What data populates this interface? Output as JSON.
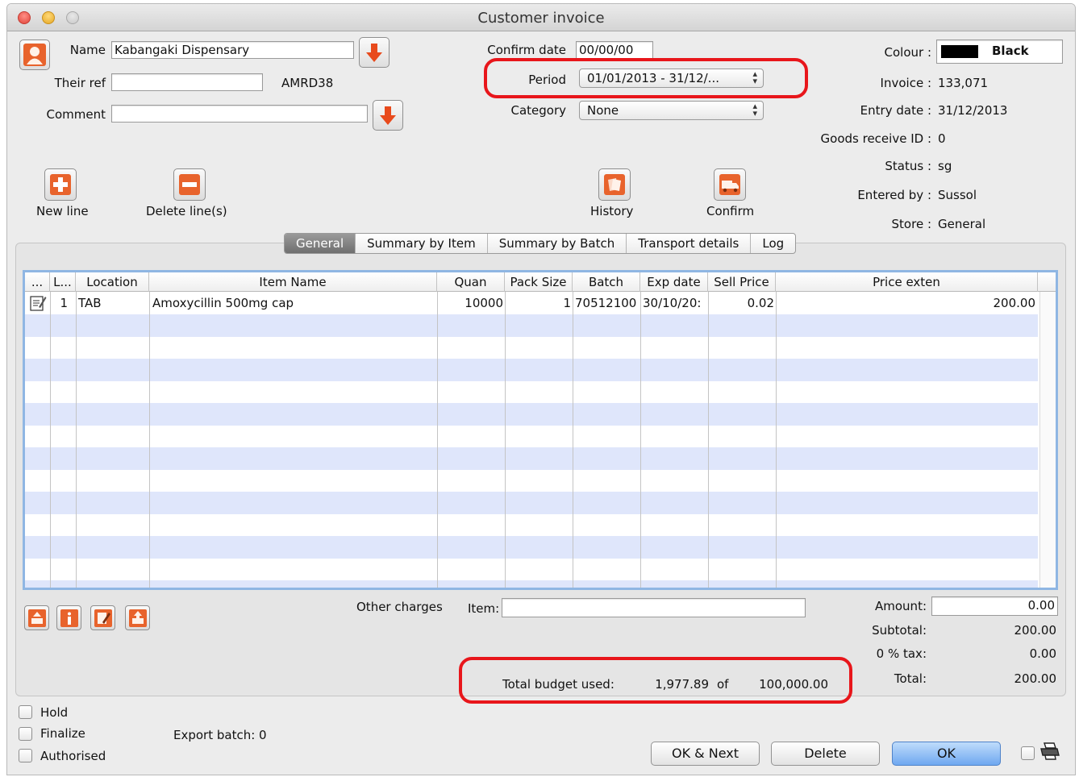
{
  "window": {
    "title": "Customer invoice"
  },
  "header": {
    "name_label": "Name",
    "name_value": "Kabangaki Dispensary",
    "their_ref_label": "Their ref",
    "their_ref_value": "",
    "code": "AMRD38",
    "comment_label": "Comment",
    "comment_value": "",
    "confirm_date_label": "Confirm date",
    "confirm_date_value": "00/00/00",
    "period_label": "Period",
    "period_value": "01/01/2013 - 31/12/...",
    "category_label": "Category",
    "category_value": "None"
  },
  "info": {
    "colour_label": "Colour :",
    "colour_value": "Black",
    "colour_swatch": "#000000",
    "invoice_label": "Invoice :",
    "invoice_value": "133,071",
    "entry_date_label": "Entry date :",
    "entry_date_value": "31/12/2013",
    "goods_receive_label": "Goods receive ID :",
    "goods_receive_value": "0",
    "status_label": "Status :",
    "status_value": "sg",
    "entered_by_label": "Entered by :",
    "entered_by_value": "Sussol",
    "store_label": "Store :",
    "store_value": "General"
  },
  "toolbar": {
    "new_line": "New line",
    "delete_lines": "Delete line(s)",
    "history": "History",
    "confirm": "Confirm"
  },
  "tabs": [
    "General",
    "Summary by Item",
    "Summary by Batch",
    "Transport details",
    "Log"
  ],
  "table": {
    "columns": [
      "...",
      "L...",
      "Location",
      "Item Name",
      "Quan",
      "Pack Size",
      "Batch",
      "Exp date",
      "Sell Price",
      "Price exten"
    ],
    "rows": [
      {
        "line": "1",
        "location": "TAB",
        "item": "Amoxycillin 500mg cap",
        "quantity": "10000",
        "pack_size": "1",
        "batch": "70512100",
        "exp_date": "30/10/20:",
        "sell_price": "0.02",
        "price_extension": "200.00"
      }
    ]
  },
  "charges": {
    "other_charges_label": "Other charges",
    "item_label": "Item:",
    "item_value": "",
    "amount_label": "Amount:",
    "amount_value": "0.00",
    "subtotal_label": "Subtotal:",
    "subtotal_value": "200.00",
    "tax_label": "0  % tax:",
    "tax_value": "0.00",
    "total_label": "Total:",
    "total_value": "200.00"
  },
  "budget": {
    "label": "Total budget used:",
    "used": "1,977.89",
    "of": "of",
    "total": "100,000.00"
  },
  "footer": {
    "hold": "Hold",
    "finalize": "Finalize",
    "authorised": "Authorised",
    "export_batch": "Export batch: 0",
    "ok_next": "OK & Next",
    "delete": "Delete",
    "ok": "OK"
  },
  "colors": {
    "highlight": "#e8161b",
    "row_alt": "#dfe6fb",
    "icon_orange": "#e8632c"
  }
}
